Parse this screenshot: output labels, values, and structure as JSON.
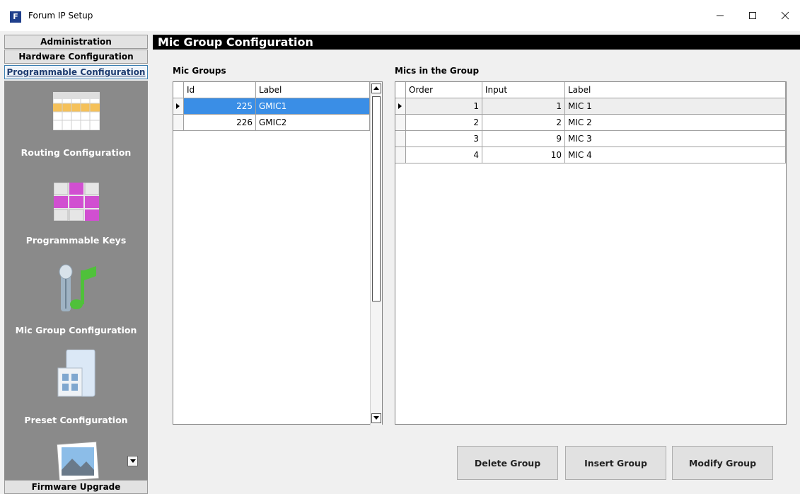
{
  "window": {
    "app_icon_letter": "F",
    "title": "Forum IP Setup"
  },
  "sidebar": {
    "tabs": {
      "administration": "Administration",
      "hardware": "Hardware Configuration",
      "programmable": "Programmable Configuration",
      "firmware": "Firmware Upgrade"
    },
    "items": [
      {
        "label": "Routing Configuration",
        "icon": "routing-grid-icon"
      },
      {
        "label": "Programmable Keys",
        "icon": "keys-grid-icon"
      },
      {
        "label": "Mic Group Configuration",
        "icon": "microphone-note-icon"
      },
      {
        "label": "Preset Configuration",
        "icon": "folder-preset-icon"
      }
    ],
    "more_icon": "photo-icon"
  },
  "main": {
    "title": "Mic Group Configuration",
    "mic_groups": {
      "label": "Mic Groups",
      "columns": [
        "Id",
        "Label"
      ],
      "rows": [
        {
          "id": "225",
          "label": "GMIC1",
          "selected": true
        },
        {
          "id": "226",
          "label": "GMIC2",
          "selected": false
        }
      ]
    },
    "mics_in_group": {
      "label": "Mics in the Group",
      "columns": [
        "Order",
        "Input",
        "Label"
      ],
      "rows": [
        {
          "order": "1",
          "input": "1",
          "label": "MIC 1"
        },
        {
          "order": "2",
          "input": "2",
          "label": "MIC 2"
        },
        {
          "order": "3",
          "input": "9",
          "label": "MIC 3"
        },
        {
          "order": "4",
          "input": "10",
          "label": "MIC 4"
        }
      ]
    },
    "buttons": {
      "delete": "Delete Group",
      "insert": "Insert Group",
      "modify": "Modify Group"
    }
  }
}
